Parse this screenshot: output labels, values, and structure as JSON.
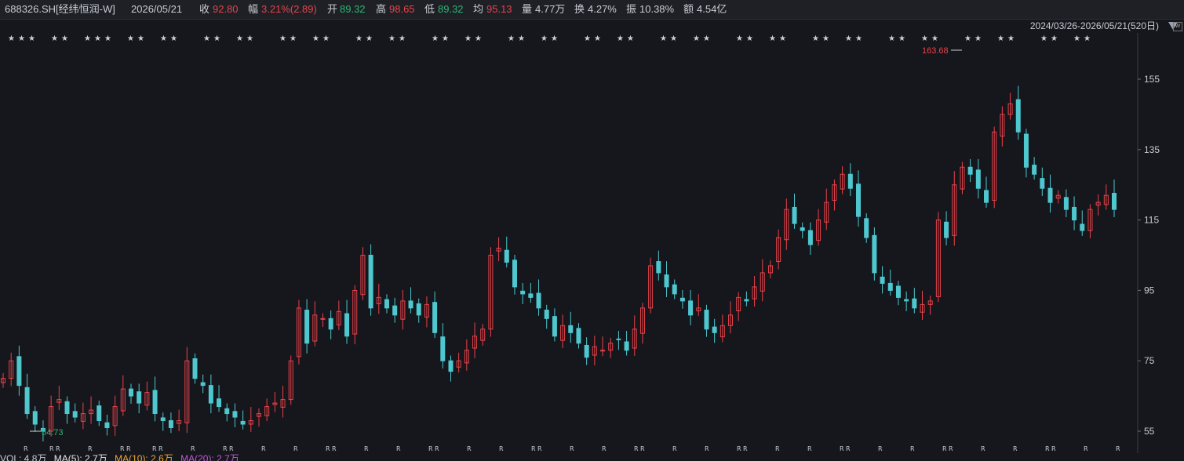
{
  "header": {
    "code": "688326.SH[经纬恒润-W]",
    "date": "2026/05/21",
    "close_label": "收",
    "close": "92.80",
    "change_label": "幅",
    "change": "3.21%(2.89)",
    "open_label": "开",
    "open": "89.32",
    "high_label": "高",
    "high": "98.65",
    "low_label": "低",
    "low": "89.32",
    "avg_label": "均",
    "avg": "95.13",
    "vol_label": "量",
    "vol": "4.77万",
    "turnover_label": "换",
    "turnover": "4.27%",
    "amplitude_label": "振",
    "amplitude": "10.38%",
    "amount_label": "额",
    "amount": "4.54亿"
  },
  "range": {
    "label": "2024/03/26-2026/05/21(520日)",
    "corner_icon": "W"
  },
  "y_axis": {
    "ticks": [
      "155",
      "135",
      "115",
      "95",
      "75",
      "55"
    ]
  },
  "annotations": {
    "max": "163.68",
    "min": "54.73"
  },
  "volume": {
    "label": "VOL: 4.8万",
    "ma5": "MA(5): 2.7万",
    "ma10": "MA(10): 2.6万",
    "ma20": "MA(20): 2.7万"
  },
  "colors": {
    "background": "#15171c",
    "up": "#e8424a",
    "down": "#2bb673",
    "down_candle": "#4fc7cf",
    "axis_text": "#c8ccd4"
  },
  "chart_data": {
    "type": "candlestick",
    "ylim": [
      50,
      170
    ],
    "high": 163.68,
    "low": 54.73,
    "x_range": [
      "2024/03/26",
      "2026/05/21"
    ],
    "days": 520,
    "series": [
      {
        "values": [
          70,
          75,
          68,
          60,
          57,
          55,
          62,
          64,
          60,
          59,
          60,
          61,
          58,
          56,
          62,
          67,
          65,
          63,
          66,
          60,
          58,
          56,
          58,
          75,
          70,
          68,
          63,
          62,
          60,
          59,
          57,
          58,
          60,
          62,
          63,
          64,
          75,
          90,
          80,
          88,
          87,
          84,
          89,
          82,
          95,
          105,
          90,
          93,
          90,
          88,
          92,
          90,
          88,
          91,
          83,
          75,
          72,
          75,
          78,
          82,
          84,
          105,
          107,
          103,
          96,
          94,
          93,
          90,
          87,
          82,
          85,
          83,
          80,
          76,
          79,
          78,
          80,
          81,
          78,
          84,
          90,
          102,
          100,
          96,
          94,
          92,
          88,
          90,
          84,
          83,
          85,
          88,
          93,
          92,
          96,
          100,
          102,
          110,
          118,
          114,
          112,
          108,
          115,
          120,
          125,
          128,
          124,
          116,
          110,
          100,
          97,
          95,
          93,
          92,
          90,
          91,
          92,
          115,
          110,
          125,
          130,
          128,
          124,
          120,
          140,
          145,
          148,
          140,
          130,
          128,
          124,
          120,
          122,
          118,
          115,
          112,
          118,
          120,
          122,
          118
        ]
      }
    ]
  }
}
